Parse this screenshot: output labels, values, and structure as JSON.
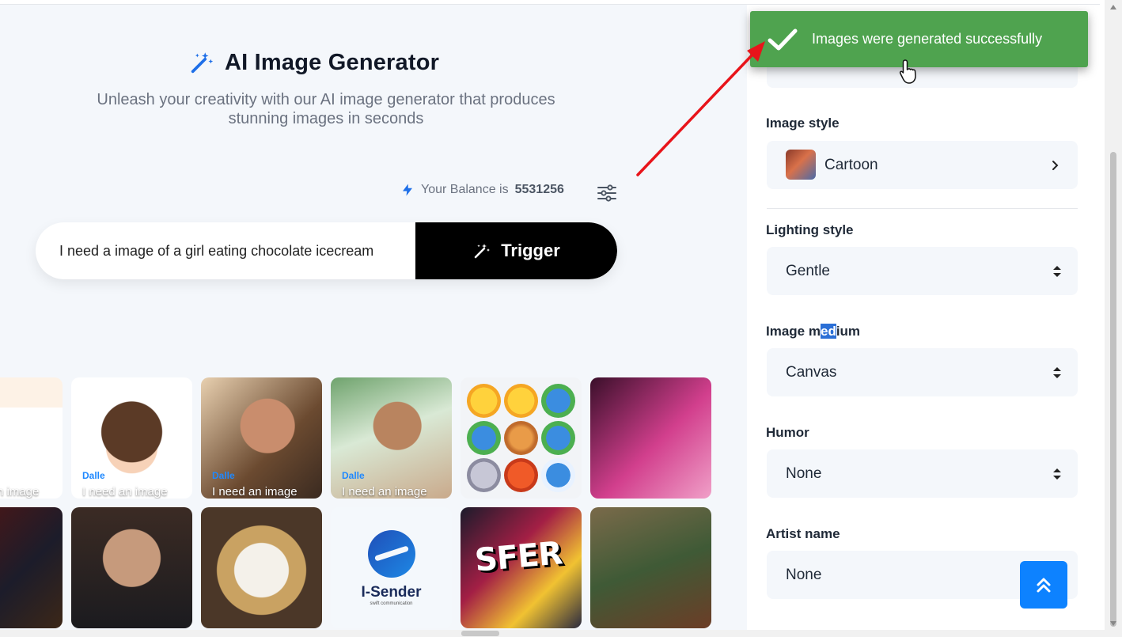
{
  "hero": {
    "title": "AI Image Generator",
    "subtitle_line1": "Unleash your creativity with our AI image generator that produces",
    "subtitle_line2": "stunning images in seconds"
  },
  "balance": {
    "prefix": "Your Balance is",
    "amount": "5531256"
  },
  "prompt": {
    "value": "I need a image of a girl eating chocolate icecream"
  },
  "trigger_label": "Trigger",
  "gallery": {
    "tag": "Dalle",
    "caption": "I need an image",
    "caption_short": "n image",
    "logo_text": "I-Sender",
    "logo_sub": "swift communication",
    "sfer_text": "SFER"
  },
  "panel": {
    "image_style_label": "Image style",
    "image_style_value": "Cartoon",
    "lighting_label": "Lighting style",
    "lighting_value": "Gentle",
    "medium_label_a": "Image m",
    "medium_label_hl": "ed",
    "medium_label_b": "ium",
    "medium_value": "Canvas",
    "humor_label": "Humor",
    "humor_value": "None",
    "artist_label": "Artist name",
    "artist_value": "None"
  },
  "toast": {
    "message": "Images were generated successfully",
    "color": "#4fa34f"
  },
  "colors": {
    "accent": "#0d82ff",
    "trigger_bg": "#000000",
    "annotation_arrow": "#e8141a"
  }
}
